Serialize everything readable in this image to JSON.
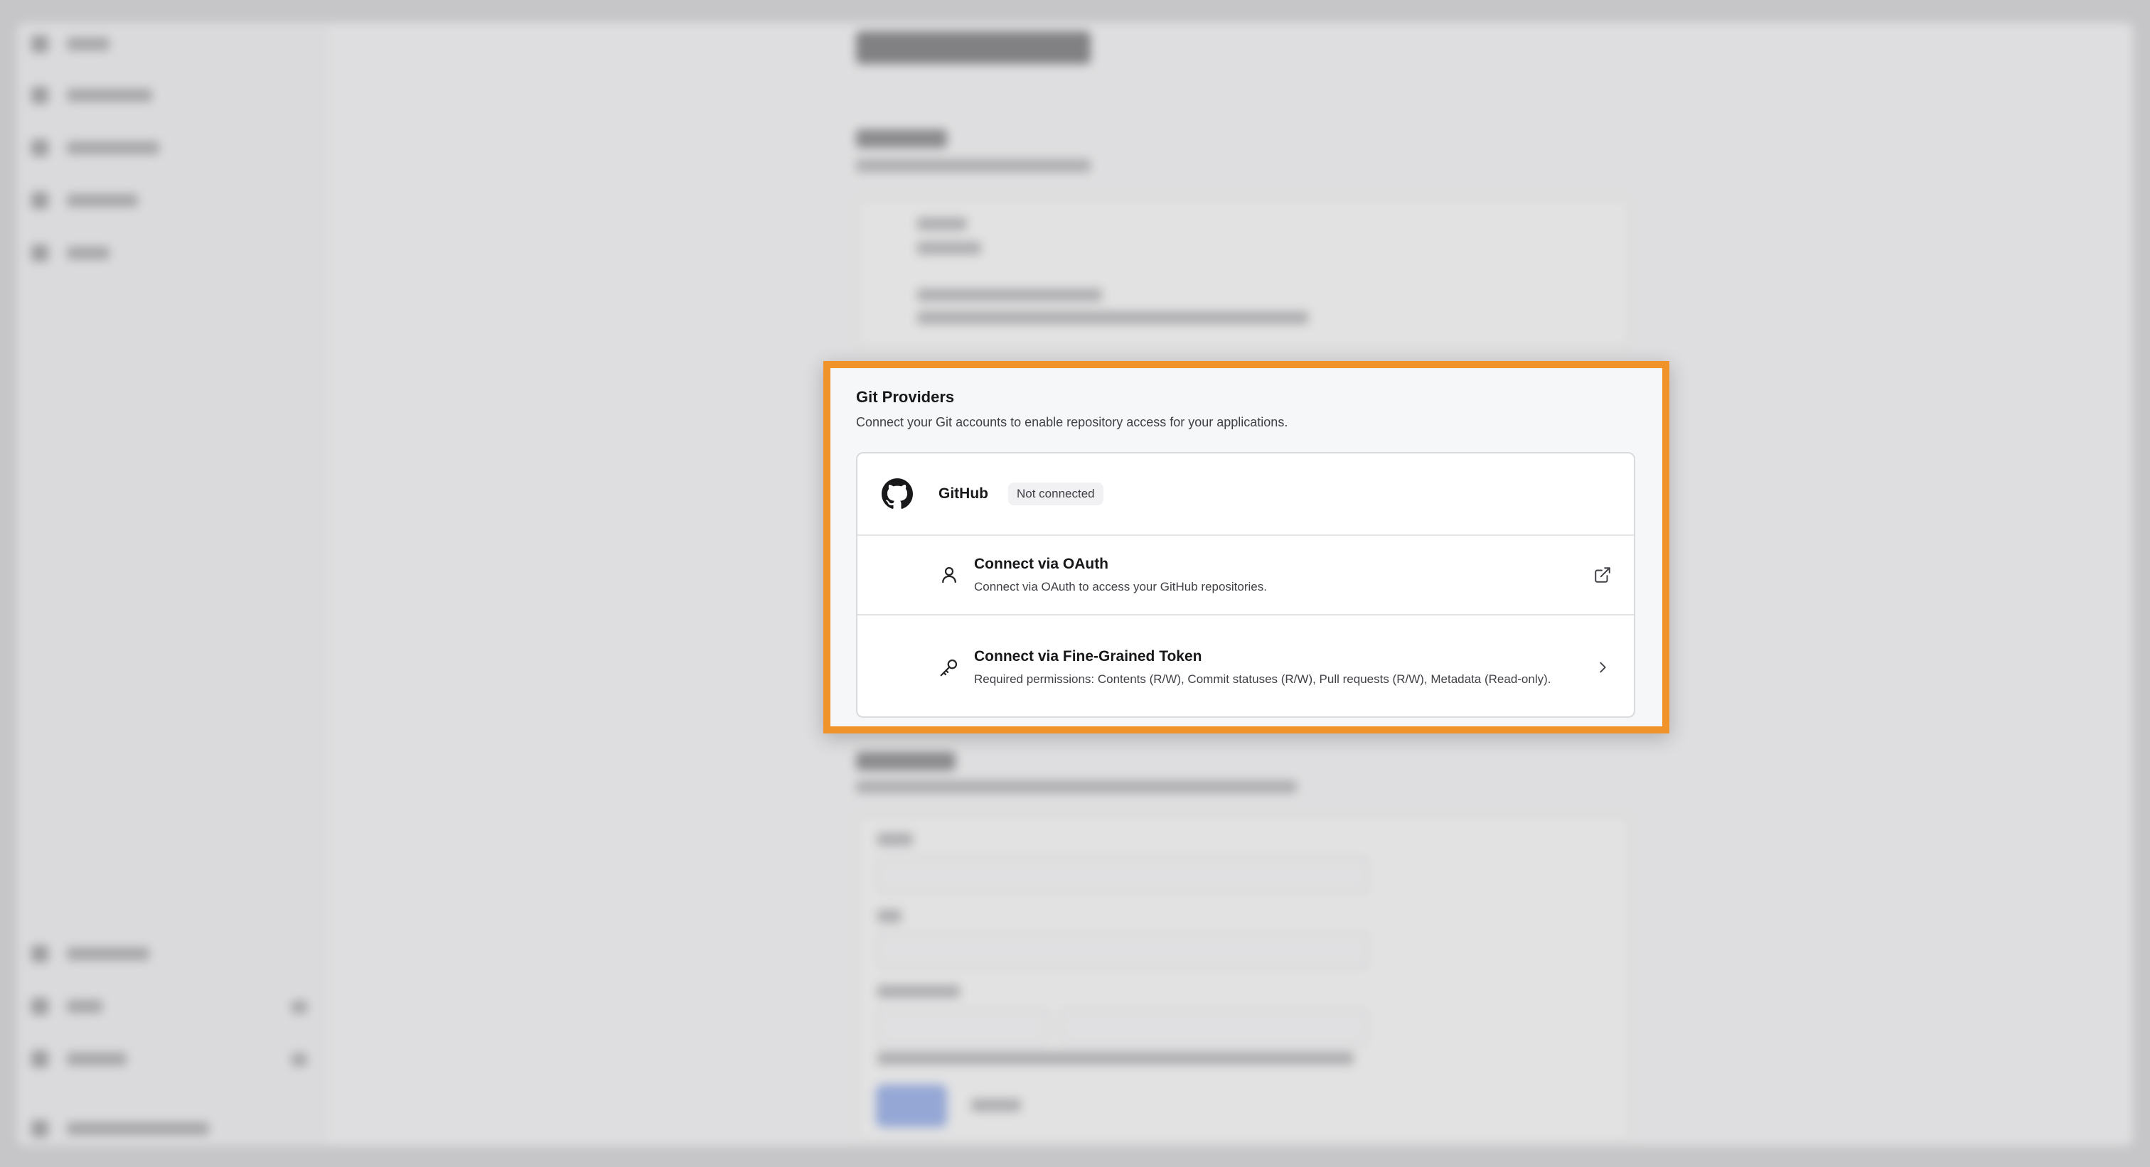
{
  "dialog": {
    "title": "Git Providers",
    "description": "Connect your Git accounts to enable repository access for your applications."
  },
  "provider": {
    "name": "GitHub",
    "status": "Not connected",
    "icon": "github-icon"
  },
  "options": [
    {
      "title": "Connect via OAuth",
      "description": "Connect via OAuth to access your GitHub repositories.",
      "icon": "user-icon",
      "action_icon": "external-link-icon"
    },
    {
      "title": "Connect via Fine-Grained Token",
      "description": "Required permissions: Contents (R/W), Commit statuses (R/W), Pull requests (R/W), Metadata (Read-only).",
      "icon": "key-icon",
      "action_icon": "chevron-right-icon"
    }
  ],
  "colors": {
    "highlight_border": "#f0932b",
    "card_background": "#ffffff",
    "backdrop": "#c6c6c8"
  }
}
